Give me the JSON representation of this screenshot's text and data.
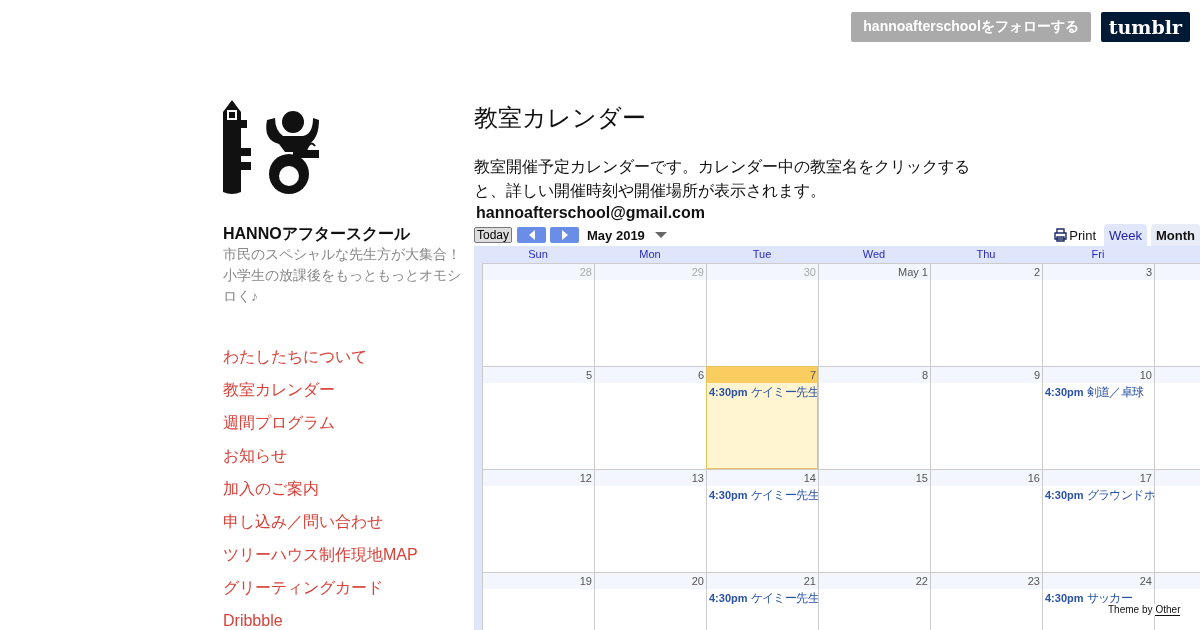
{
  "header": {
    "follow_button": "hannoafterschoolをフォローする",
    "logo": "tumblr"
  },
  "sidebar": {
    "title": "HANNOアフタースクール",
    "description": "市民のスペシャルな先生方が大集合！小学生の放課後をもっともっとオモシロく♪",
    "nav": [
      "わたしたちについて",
      "教室カレンダー",
      "週間プログラム",
      "お知らせ",
      "加入のご案内",
      "申し込み／問い合わせ",
      "ツリーハウス制作現地MAP",
      "グリーティングカード",
      "Dribbble"
    ]
  },
  "main": {
    "heading": "教室カレンダー",
    "intro": "教室開催予定カレンダーです。カレンダー中の教室名をクリックすると、詳しい開催時刻や開催場所が表示されます。",
    "email": "hannoafterschool@gmail.com"
  },
  "calendar": {
    "today_button": "Today",
    "month_label": "May 2019",
    "print": "Print",
    "views": [
      {
        "label": "Week",
        "selected": false
      },
      {
        "label": "Month",
        "selected": true
      }
    ],
    "weekdays": [
      "Sun",
      "Mon",
      "Tue",
      "Wed",
      "Thu",
      "Fri"
    ],
    "weeks": [
      {
        "days": [
          {
            "label": "28",
            "other_month": true,
            "today": false
          },
          {
            "label": "29",
            "other_month": true,
            "today": false
          },
          {
            "label": "30",
            "other_month": true,
            "today": false
          },
          {
            "label": "May 1",
            "other_month": false,
            "today": false
          },
          {
            "label": "2",
            "other_month": false,
            "today": false
          },
          {
            "label": "3",
            "other_month": false,
            "today": false
          }
        ]
      },
      {
        "days": [
          {
            "label": "5",
            "other_month": false,
            "today": false
          },
          {
            "label": "6",
            "other_month": false,
            "today": false
          },
          {
            "label": "7",
            "other_month": false,
            "today": true,
            "events": [
              {
                "time": "4:30pm",
                "title": "ケイミー先生"
              }
            ]
          },
          {
            "label": "8",
            "other_month": false,
            "today": false
          },
          {
            "label": "9",
            "other_month": false,
            "today": false
          },
          {
            "label": "10",
            "other_month": false,
            "today": false,
            "events": [
              {
                "time": "4:30pm",
                "title": "剣道／卓球"
              }
            ]
          }
        ]
      },
      {
        "days": [
          {
            "label": "12",
            "other_month": false,
            "today": false
          },
          {
            "label": "13",
            "other_month": false,
            "today": false
          },
          {
            "label": "14",
            "other_month": false,
            "today": false,
            "events": [
              {
                "time": "4:30pm",
                "title": "ケイミー先生"
              }
            ]
          },
          {
            "label": "15",
            "other_month": false,
            "today": false
          },
          {
            "label": "16",
            "other_month": false,
            "today": false
          },
          {
            "label": "17",
            "other_month": false,
            "today": false,
            "events": [
              {
                "time": "4:30pm",
                "title": "グラウンドホ"
              }
            ]
          }
        ]
      },
      {
        "days": [
          {
            "label": "19",
            "other_month": false,
            "today": false
          },
          {
            "label": "20",
            "other_month": false,
            "today": false
          },
          {
            "label": "21",
            "other_month": false,
            "today": false,
            "events": [
              {
                "time": "4:30pm",
                "title": "ケイミー先生"
              }
            ]
          },
          {
            "label": "22",
            "other_month": false,
            "today": false
          },
          {
            "label": "23",
            "other_month": false,
            "today": false
          },
          {
            "label": "24",
            "other_month": false,
            "today": false,
            "events": [
              {
                "time": "4:30pm",
                "title": "サッカー"
              }
            ]
          }
        ]
      }
    ]
  },
  "footer": {
    "prefix": "Theme by",
    "link": "Other"
  }
}
